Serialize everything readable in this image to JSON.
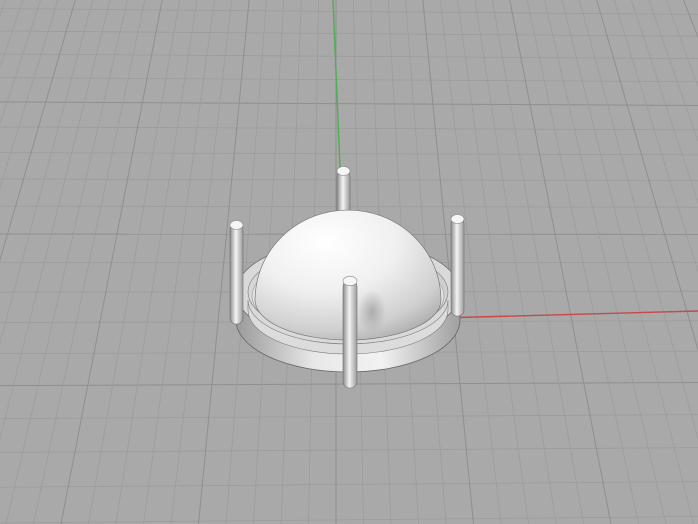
{
  "viewport": {
    "view": "perspective",
    "background_color": "#a9a9a9",
    "grid_minor_color": "#9c9c9c",
    "grid_major_color": "#8f8f8f",
    "axis_colors": {
      "x": "#c64a4a",
      "y": "#4caf50"
    }
  },
  "scene": {
    "objects": [
      {
        "name": "dome",
        "type": "hemisphere",
        "color": "#f2f2f2"
      },
      {
        "name": "bezel-ring",
        "type": "ring",
        "color": "#d6d6d6"
      },
      {
        "name": "prong",
        "count": 4,
        "color": "#dcdcdc"
      }
    ]
  }
}
